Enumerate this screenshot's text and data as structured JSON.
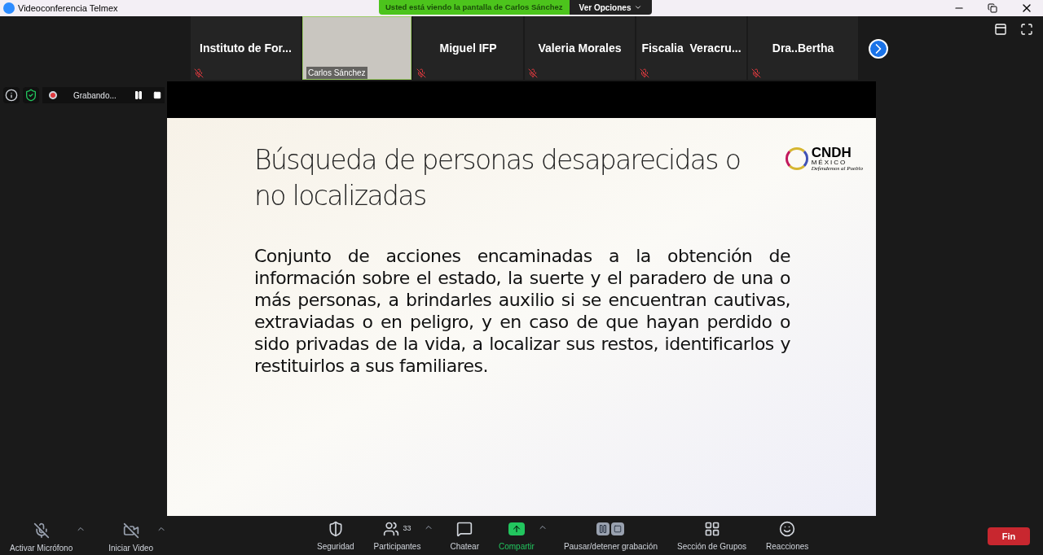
{
  "window": {
    "title": "Videoconferencia Telmex"
  },
  "share_banner": {
    "text": "Usted está viendo la pantalla de Carlos Sánchez",
    "options": "Ver Opciones"
  },
  "participants": [
    {
      "kind": "name",
      "name": "Instituto de For...",
      "muted": true
    },
    {
      "kind": "video",
      "name": "Carlos Sánchez"
    },
    {
      "kind": "name",
      "name": "Miguel IFP",
      "muted": true
    },
    {
      "kind": "name",
      "name": "Valeria Morales",
      "muted": true
    },
    {
      "kind": "name",
      "name": "Fiscalia  Veracru...",
      "muted": true
    },
    {
      "kind": "name",
      "name": "Dra..Bertha",
      "muted": true
    }
  ],
  "recording": {
    "label": "Grabando..."
  },
  "slide": {
    "title": "Búsqueda de personas desaparecidas o no localizadas",
    "body": "Conjunto de acciones encaminadas a la obtención de información sobre el estado, la suerte y el paradero de una o más personas, a brindarles auxilio si se encuentran cautivas, extraviadas o en peligro, y en caso de que hayan perdido o sido privadas de la vida, a localizar sus restos, identificarlos y restituirlos a sus familiares.",
    "logo": {
      "name": "CNDH",
      "country": "MÉXICO",
      "motto": "Defendemos al Pueblo"
    }
  },
  "toolbar_left": [
    {
      "kind": "mic",
      "label": "Activar Micrófono",
      "caret": true
    },
    {
      "kind": "video",
      "label": "Iniciar Video",
      "caret": true
    }
  ],
  "toolbar_center": [
    {
      "kind": "security",
      "label": "Seguridad",
      "caret": false,
      "active": false
    },
    {
      "kind": "participants",
      "label": "Participantes",
      "count": "33",
      "caret": true,
      "active": false
    },
    {
      "kind": "chat",
      "label": "Chatear",
      "caret": false,
      "active": false
    },
    {
      "kind": "share",
      "label": "Compartir",
      "caret": true,
      "active": true
    },
    {
      "kind": "record",
      "label": "Pausar/detener grabación",
      "caret": false,
      "active": false
    },
    {
      "kind": "groups",
      "label": "Sección de Grupos",
      "caret": false,
      "active": false
    },
    {
      "kind": "reactions",
      "label": "Reacciones",
      "caret": false,
      "active": false
    }
  ],
  "end_button": "Fin"
}
